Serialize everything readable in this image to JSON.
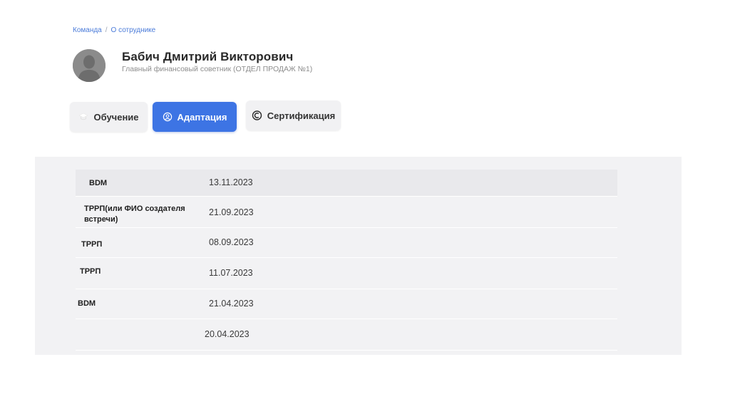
{
  "breadcrumb": {
    "items": [
      "Команда",
      "О сотруднике"
    ],
    "separator": "/"
  },
  "profile": {
    "name": "Бабич Дмитрий Викторович",
    "position": "Главный финансовый советник (ОТДЕЛ ПРОДАЖ №1)",
    "avatar_icon": "user-silhouette-icon"
  },
  "tabs": [
    {
      "label": "Обучение",
      "icon": "graduation-cap-icon",
      "active": false
    },
    {
      "label": "Адаптация",
      "icon": "user-circle-icon",
      "active": true
    },
    {
      "label": "Сертификация",
      "icon": "certificate-icon",
      "active": false
    }
  ],
  "table": {
    "rows": [
      {
        "type": "BDM",
        "date": "13.11.2023"
      },
      {
        "type": "ТРРП(или ФИО создателя встречи)",
        "date": "21.09.2023"
      },
      {
        "type": "ТРРП",
        "date": "08.09.2023"
      },
      {
        "type": "ТРРП",
        "date": "11.07.2023"
      },
      {
        "type": "BDM",
        "date": "21.04.2023"
      },
      {
        "type": "",
        "date": "20.04.2023"
      }
    ]
  },
  "colors": {
    "accent": "#3d74e4",
    "link": "#4a7bd9",
    "panel_bg": "#f2f2f4",
    "tab_bg": "#f1f1f3"
  }
}
